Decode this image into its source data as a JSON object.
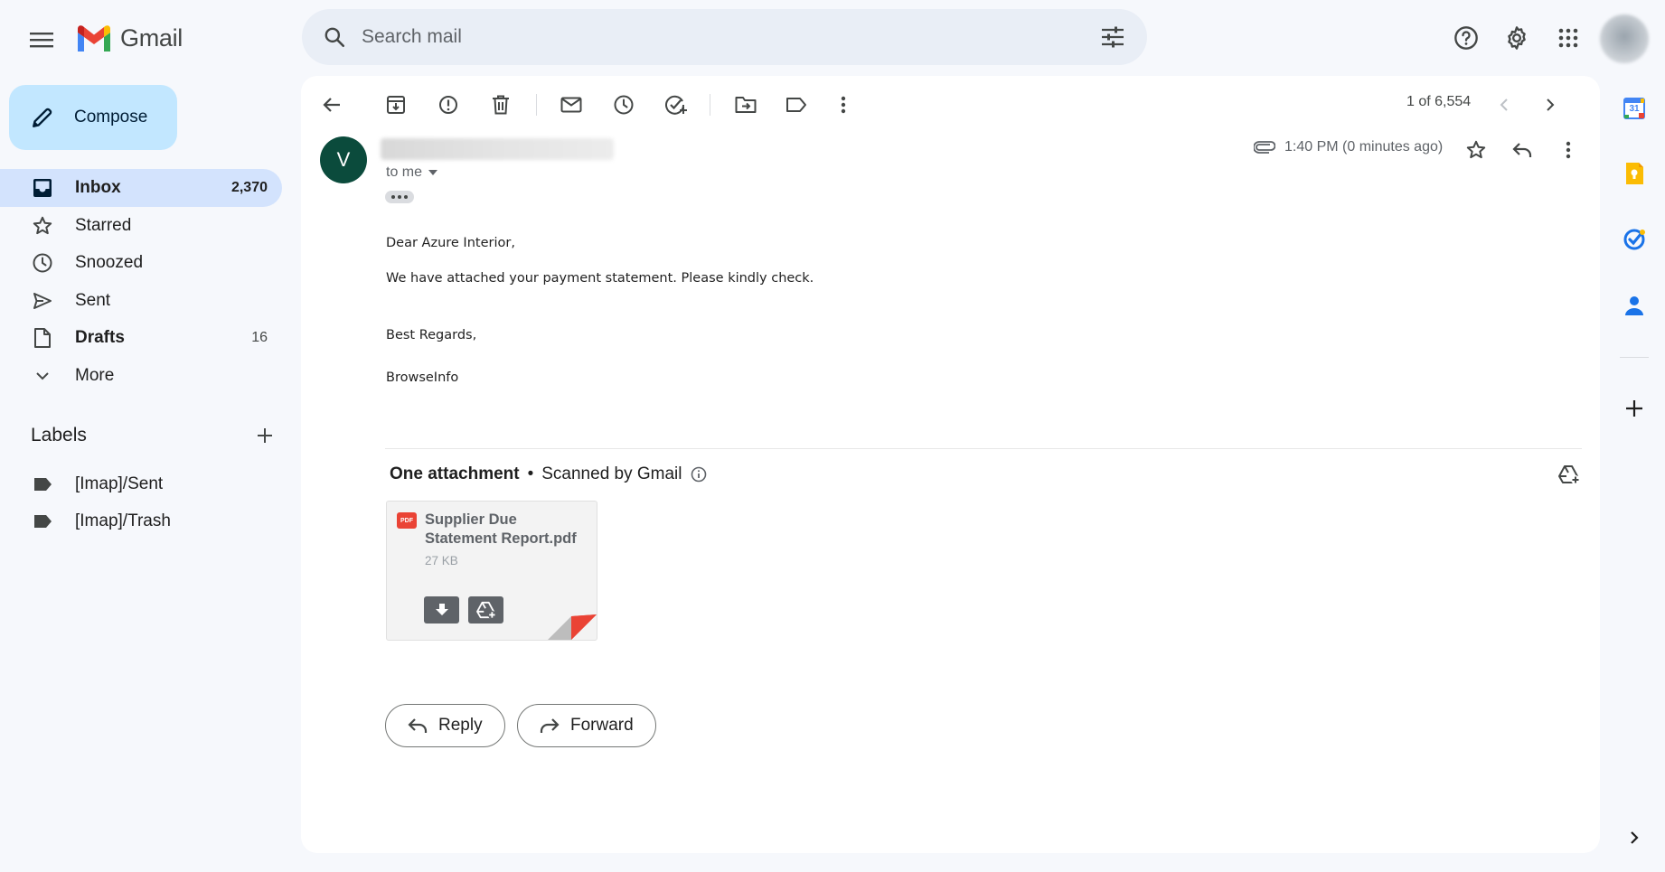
{
  "app": {
    "name": "Gmail"
  },
  "search": {
    "placeholder": "Search mail"
  },
  "compose": {
    "label": "Compose"
  },
  "nav": {
    "items": [
      {
        "label": "Inbox",
        "count": "2,370"
      },
      {
        "label": "Starred",
        "count": ""
      },
      {
        "label": "Snoozed",
        "count": ""
      },
      {
        "label": "Sent",
        "count": ""
      },
      {
        "label": "Drafts",
        "count": "16"
      },
      {
        "label": "More",
        "count": ""
      }
    ]
  },
  "labels": {
    "title": "Labels",
    "items": [
      {
        "label": "[Imap]/Sent"
      },
      {
        "label": "[Imap]/Trash"
      }
    ]
  },
  "toolbar": {
    "pager": "1 of 6,554"
  },
  "message": {
    "sender_initial": "V",
    "recipient": "to me",
    "time": "1:40 PM (0 minutes ago)",
    "body": {
      "greeting": "Dear Azure Interior,",
      "line1": "We have attached your payment statement. Please kindly check.",
      "closing": "Best Regards,",
      "signature": "BrowseInfo"
    }
  },
  "attachments": {
    "header": "One attachment",
    "separator": "•",
    "scanned": "Scanned by Gmail",
    "file": {
      "type_badge": "PDF",
      "name": "Supplier Due Statement Report.pdf",
      "size": "27 KB"
    }
  },
  "actions": {
    "reply": "Reply",
    "forward": "Forward"
  },
  "rail": {
    "calendar_day": "31"
  },
  "colors": {
    "accent": "#0b57d0",
    "compose_bg": "#c2e7ff",
    "active_nav": "#d3e3fd",
    "avatar": "#0b4b3c"
  },
  "icons": [
    "menu-icon",
    "gmail-logo-icon",
    "search-icon",
    "tune-icon",
    "help-icon",
    "gear-icon",
    "apps-icon",
    "pencil-icon",
    "inbox-icon",
    "star-icon",
    "clock-icon",
    "send-icon",
    "draft-icon",
    "chevron-down-icon",
    "plus-icon",
    "label-icon",
    "back-icon",
    "archive-icon",
    "report-spam-icon",
    "delete-icon",
    "mark-unread-icon",
    "snooze-icon",
    "add-task-icon",
    "move-to-icon",
    "label-as-icon",
    "more-vert-icon",
    "chevron-left-icon",
    "chevron-right-icon",
    "paperclip-icon",
    "reply-icon",
    "forward-icon",
    "info-icon",
    "add-to-drive-icon",
    "download-icon",
    "calendar-icon",
    "keep-icon",
    "tasks-icon",
    "contacts-icon"
  ]
}
